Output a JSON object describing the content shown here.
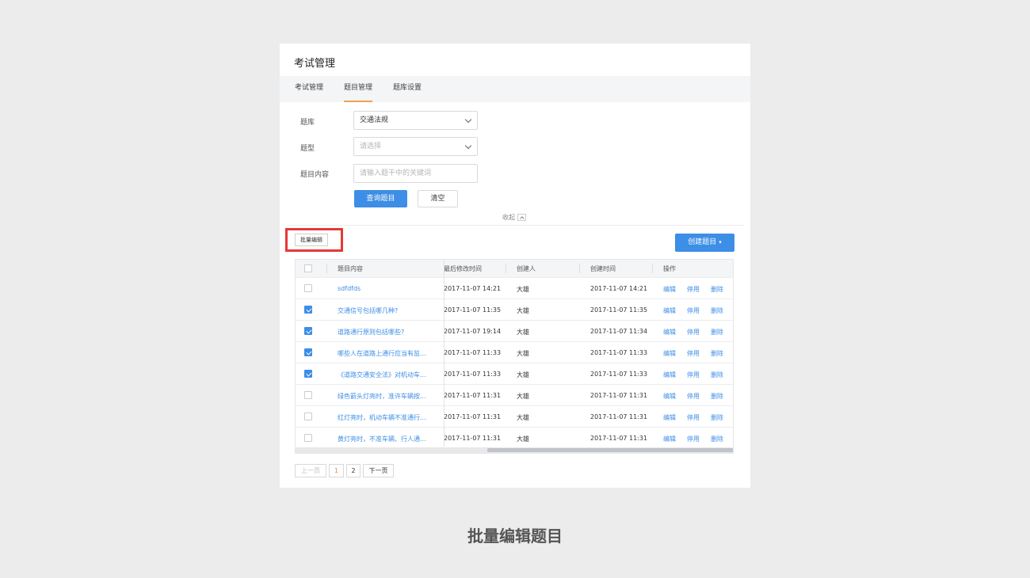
{
  "panel": {
    "title": "考试管理",
    "tabs": [
      {
        "label": "考试管理"
      },
      {
        "label": "题目管理",
        "active": true
      },
      {
        "label": "题库设置"
      }
    ]
  },
  "filter": {
    "bank_label": "题库",
    "bank_value": "交通法规",
    "type_label": "题型",
    "type_placeholder": "请选择",
    "content_label": "题目内容",
    "content_placeholder": "请输入题干中的关键词",
    "query_button": "查询题目",
    "clear_button": "清空",
    "collapse_label": "收起"
  },
  "toolbar": {
    "batch_edit_label": "批量编辑",
    "create_label": "创建题目",
    "create_caret": "▾"
  },
  "table": {
    "columns": [
      "题目内容",
      "最后修改时间",
      "创建人",
      "创建时间",
      "操作"
    ],
    "actions": [
      "编辑",
      "停用",
      "删除"
    ],
    "rows": [
      {
        "content": "sdfdfds",
        "modified": "2017-11-07 14:21",
        "creator": "大雄",
        "created": "2017-11-07 14:21",
        "checked": false
      },
      {
        "content": "交通信号包括哪几种?",
        "modified": "2017-11-07 11:35",
        "creator": "大雄",
        "created": "2017-11-07 11:35",
        "checked": true
      },
      {
        "content": "道路通行原则包括哪些?",
        "modified": "2017-11-07 19:14",
        "creator": "大雄",
        "created": "2017-11-07 11:34",
        "checked": true
      },
      {
        "content": "哪些人在道路上通行应当有监...",
        "modified": "2017-11-07 11:33",
        "creator": "大雄",
        "created": "2017-11-07 11:33",
        "checked": true
      },
      {
        "content": "《道路交通安全法》对机动车...",
        "modified": "2017-11-07 11:33",
        "creator": "大雄",
        "created": "2017-11-07 11:33",
        "checked": true
      },
      {
        "content": "绿色箭头灯亮时，准许车辆按...",
        "modified": "2017-11-07 11:31",
        "creator": "大雄",
        "created": "2017-11-07 11:31",
        "checked": false
      },
      {
        "content": "红灯亮时，机动车辆不准通行...",
        "modified": "2017-11-07 11:31",
        "creator": "大雄",
        "created": "2017-11-07 11:31",
        "checked": false
      },
      {
        "content": "黄灯亮时，不准车辆、行人通...",
        "modified": "2017-11-07 11:31",
        "creator": "大雄",
        "created": "2017-11-07 11:31",
        "checked": false
      }
    ]
  },
  "pagination": {
    "prev_label": "上一页",
    "pages": [
      "1",
      "2"
    ],
    "current": "1",
    "next_label": "下一页"
  },
  "caption": "批量编辑题目",
  "colors": {
    "accent": "#3d8ee6",
    "tab_underline": "#f0a050",
    "highlight_border": "#e53935",
    "current_page": "#f08a2c"
  }
}
